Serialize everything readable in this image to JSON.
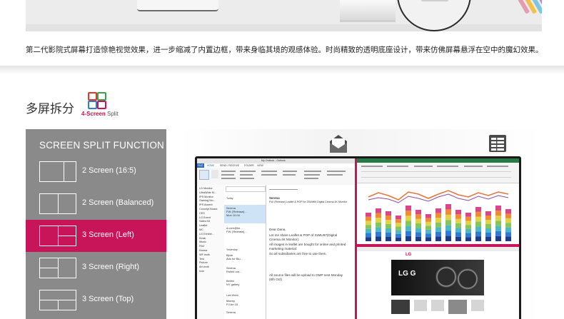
{
  "caption": "第二代影院式屏幕打造惊艳视觉效果，进一步缩减了内置边框，带来身临其境的观感体验。时尚精致的透明底座设计，带来仿佛屏幕悬浮在空中的魔幻效果。",
  "section": {
    "title": "多屏拆分",
    "icon_name": "four-screen-split-icon",
    "icon_caption_accent": "4-Screen",
    "icon_caption_rest": " Split"
  },
  "menu": {
    "title": "SCREEN SPLIT FUNCTION",
    "active_color": "#c8155a",
    "options": [
      {
        "label": "2 Screen (16:5)",
        "layout": "vertical-split",
        "active": false
      },
      {
        "label": "2 Screen (Balanced)",
        "layout": "vertical-split-wide",
        "active": false
      },
      {
        "label": "3 Screen (Left)",
        "layout": "left-big",
        "active": true
      },
      {
        "label": "3 Screen (Right)",
        "layout": "right-big",
        "active": false
      },
      {
        "label": "3 Screen (Top)",
        "layout": "top-big",
        "active": false
      }
    ]
  },
  "monitor": {
    "icons": [
      "mail-icon",
      "spreadsheet-icon"
    ],
    "outlook": {
      "titlebar": "My Outlook - Outlook",
      "tabs": [
        "FILE",
        "HOME",
        "SEND / RECEIVE",
        "FOLDER",
        "VIEW"
      ],
      "nav": [
        "LG Monitor",
        "UltraWide M...",
        "IPS Monitor",
        "Gaming Mo...",
        "IPS Accent",
        "Concept Board",
        "CES",
        "LG Event",
        "Sales Kit",
        "Leaflet",
        "MC",
        "LG Exhibit...",
        "Kiosk",
        "Music",
        "Film",
        "Karma",
        "WF work",
        "Test",
        "Picture",
        "Art work",
        "Icon"
      ],
      "list": [
        {
          "sender": "Serena",
          "subject": "FW: [Release]...",
          "date": "Mon 10:04"
        },
        {
          "sender": "d.corn@ke...",
          "subject": "FW: [Release]...",
          "date": "Mon 9:49"
        },
        {
          "sender": "Bjork",
          "subject": "Ads for Blu...",
          "date": "Mon 5:22"
        },
        {
          "sender": "Serena",
          "subject": "Rolled out...",
          "date": "Mon 3:48"
        },
        {
          "sender": "Bellmi",
          "subject": "NY gallery",
          "date": "12:00"
        },
        {
          "sender": "Manny",
          "subject": "PJ Art 15",
          "date": "12:00"
        },
        {
          "sender": "Serena",
          "subject": "Shopping list",
          "date": "12:00"
        }
      ],
      "list_groups": [
        "Today",
        "Yesterday",
        "Last Week"
      ],
      "read": {
        "from": "Serena",
        "subject": "FW: [Release] Leaflet & POP for 25UM65 Digital Cinema 4K Monitor",
        "greeting": "Dear Dana,",
        "body": [
          "Let me share Leaflet & POP of 31MU97(Digital",
          "Cinema 4K Monitor).",
          "All images in leaflet are bought for online and printed",
          "marketing material.",
          "So all subsidiaries are free to use them."
        ],
        "footer": [
          "All source files will be upload to GMP next Monday",
          "(6th Oct)"
        ]
      }
    },
    "web": {
      "brand": "LG",
      "hero": "LG G"
    }
  }
}
